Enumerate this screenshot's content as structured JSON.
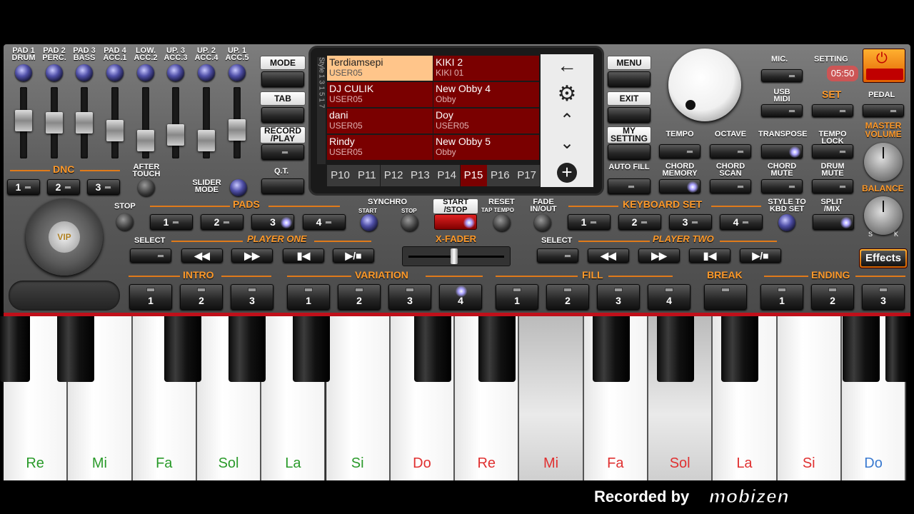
{
  "pad_knobs": [
    "PAD 1 DRUM",
    "PAD 2 PERC.",
    "PAD 3 BASS",
    "PAD 4 ACC.1",
    "LOW. ACC.2",
    "UP. 3 ACC.3",
    "UP. 2 ACC.4",
    "UP. 1 ACC.5"
  ],
  "dnc": {
    "label": "DNC",
    "buttons": [
      "1",
      "2",
      "3"
    ],
    "after_touch": "AFTER TOUCH",
    "slider_mode": "SLIDER MODE"
  },
  "left_buttons": {
    "mode": "MODE",
    "tab": "TAB",
    "record_play": "RECORD /PLAY",
    "qt": "Q.T."
  },
  "screen": {
    "side_label": "Style",
    "side_numbers": "1 3 1 5 1 7",
    "styles": [
      {
        "name": "Terdiamsepi",
        "bank": "USER05",
        "selected": true
      },
      {
        "name": "KIKI 2",
        "bank": "KIKI 01",
        "selected": false
      },
      {
        "name": "DJ CULIK",
        "bank": "USER05",
        "selected": false
      },
      {
        "name": "New Obby 4",
        "bank": "Obby",
        "selected": false
      },
      {
        "name": "dani",
        "bank": "USER05",
        "selected": false
      },
      {
        "name": "Doy",
        "bank": "USER05",
        "selected": false
      },
      {
        "name": "Rindy",
        "bank": "USER05",
        "selected": false
      },
      {
        "name": "New Obby 5",
        "bank": "Obby",
        "selected": false
      }
    ],
    "pages": [
      "P10",
      "P11",
      "P12",
      "P13",
      "P14",
      "P15",
      "P16",
      "P17"
    ],
    "active_page": "P15",
    "nav": [
      "back-arrow-icon",
      "gear-icon",
      "chevron-up-icon",
      "chevron-down-icon",
      "plus-circle-icon"
    ]
  },
  "right_screen_buttons": {
    "menu": "MENU",
    "exit": "EXIT",
    "my_setting": "MY SETTING",
    "auto_fill": "AUTO FILL"
  },
  "top_right": {
    "mic": "MIC.",
    "setting": "SETTING",
    "time": "05:50",
    "usb_midi": "USB MIDI",
    "set": "SET",
    "pedal": "PEDAL",
    "master_volume": "MASTER VOLUME",
    "balance": "BALANCE",
    "bal_left": "S",
    "bal_right": "K"
  },
  "function_row1": [
    "TEMPO",
    "OCTAVE",
    "TRANSPOSE",
    "TEMPO LOCK"
  ],
  "function_row2": [
    "CHORD MEMORY",
    "CHORD SCAN",
    "CHORD MUTE",
    "DRUM MUTE"
  ],
  "pads": {
    "stop": "STOP",
    "label": "PADS",
    "buttons": [
      "1",
      "2",
      "3",
      "4"
    ]
  },
  "synchro": {
    "label": "SYNCHRO",
    "start": "START",
    "stop": "STOP"
  },
  "transport": {
    "start_stop": "START /STOP",
    "reset": "RESET",
    "tap_tempo": "TAP TEMPO",
    "fade": "FADE IN/OUT"
  },
  "keyboard_set": {
    "label": "KEYBOARD SET",
    "buttons": [
      "1",
      "2",
      "3",
      "4"
    ],
    "style_to_kbd": "STYLE TO KBD SET",
    "split_mix": "SPLIT /MIX"
  },
  "player_one": {
    "select": "SELECT",
    "label": "PLAYER ONE"
  },
  "player_two": {
    "select": "SELECT",
    "label": "PLAYER TWO"
  },
  "xfader": "X-FADER",
  "effects": "Effects",
  "vip": "VIP",
  "sections": {
    "intro": {
      "label": "INTRO",
      "buttons": [
        "1",
        "2",
        "3"
      ]
    },
    "variation": {
      "label": "VARIATION",
      "buttons": [
        "1",
        "2",
        "3",
        "4"
      ]
    },
    "fill": {
      "label": "FILL",
      "buttons": [
        "1",
        "2",
        "3",
        "4"
      ]
    },
    "break": {
      "label": "BREAK"
    },
    "ending": {
      "label": "ENDING",
      "buttons": [
        "1",
        "2",
        "3"
      ]
    }
  },
  "keys": [
    {
      "note": "Re",
      "color": "#2a9a2a",
      "pressed": false
    },
    {
      "note": "Mi",
      "color": "#2a9a2a",
      "pressed": false
    },
    {
      "note": "Fa",
      "color": "#2a9a2a",
      "pressed": false
    },
    {
      "note": "Sol",
      "color": "#2a9a2a",
      "pressed": false
    },
    {
      "note": "La",
      "color": "#2a9a2a",
      "pressed": false
    },
    {
      "note": "Si",
      "color": "#2a9a2a",
      "pressed": false
    },
    {
      "note": "Do",
      "color": "#e03030",
      "pressed": false
    },
    {
      "note": "Re",
      "color": "#e03030",
      "pressed": false
    },
    {
      "note": "Mi",
      "color": "#e03030",
      "pressed": true
    },
    {
      "note": "Fa",
      "color": "#e03030",
      "pressed": false
    },
    {
      "note": "Sol",
      "color": "#e03030",
      "pressed": true
    },
    {
      "note": "La",
      "color": "#e03030",
      "pressed": false
    },
    {
      "note": "Si",
      "color": "#e03030",
      "pressed": false
    },
    {
      "note": "Do",
      "color": "#3a7ad0",
      "pressed": false
    }
  ],
  "watermark": "Recorded by",
  "watermark_brand": "mobizen"
}
